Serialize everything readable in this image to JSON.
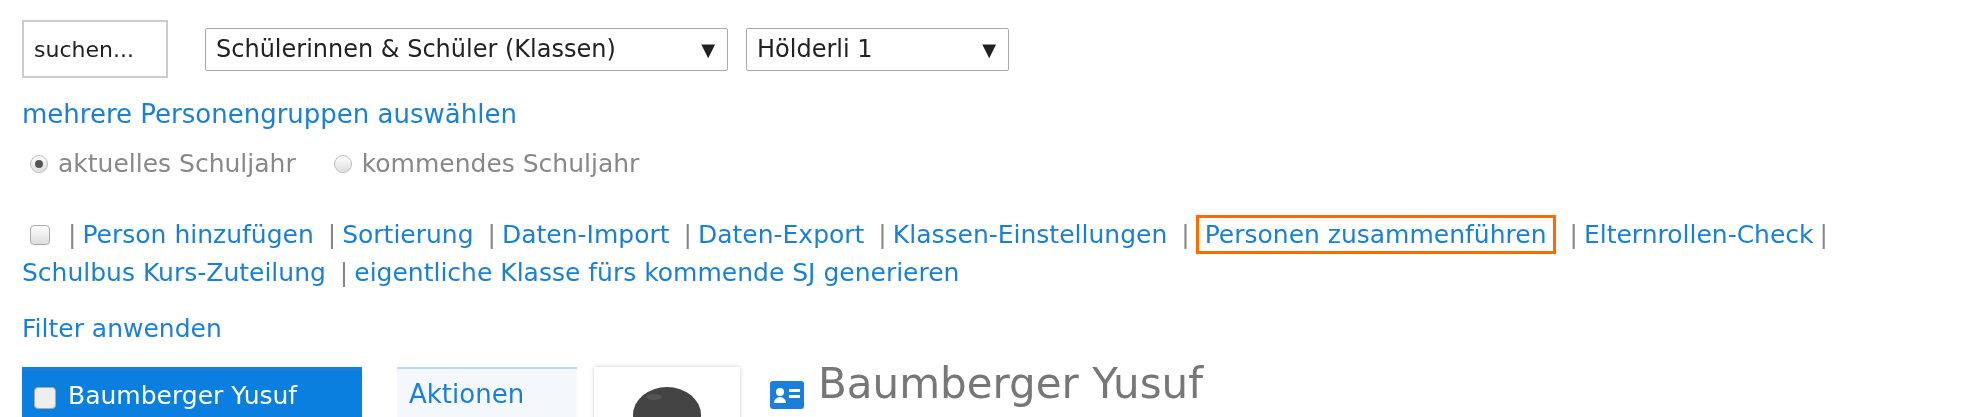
{
  "search": {
    "value": "suchen..."
  },
  "selects": [
    {
      "value": "Schülerinnen & Schüler (Klassen)",
      "arrow": "▼"
    },
    {
      "value": "Hölderli 1",
      "arrow": "▼"
    }
  ],
  "multi_link": "mehrere Personengruppen auswählen",
  "year_options": [
    {
      "label": "aktuelles Schuljahr",
      "selected": true
    },
    {
      "label": "kommendes Schuljahr",
      "selected": false
    }
  ],
  "actions": {
    "checked": false,
    "separator": "|",
    "links": [
      {
        "label": "Person hinzufügen",
        "highlighted": false
      },
      {
        "label": "Sortierung",
        "highlighted": false
      },
      {
        "label": "Daten-Import",
        "highlighted": false
      },
      {
        "label": "Daten-Export",
        "highlighted": false
      },
      {
        "label": "Klassen-Einstellungen",
        "highlighted": false
      },
      {
        "label": "Personen zusammenführen",
        "highlighted": true
      },
      {
        "label": "Elternrollen-Check",
        "highlighted": false
      },
      {
        "label": "Schulbus Kurs-Zuteilung",
        "highlighted": false
      },
      {
        "label": "eigentliche Klasse fürs kommende SJ generieren",
        "highlighted": false
      }
    ]
  },
  "filter_link": "Filter anwenden",
  "person_list": [
    {
      "name": "Baumberger Yusuf",
      "checked": false,
      "selected": true
    }
  ],
  "actions_panel": {
    "title": "Aktionen"
  },
  "detail": {
    "name": "Baumberger Yusuf"
  }
}
